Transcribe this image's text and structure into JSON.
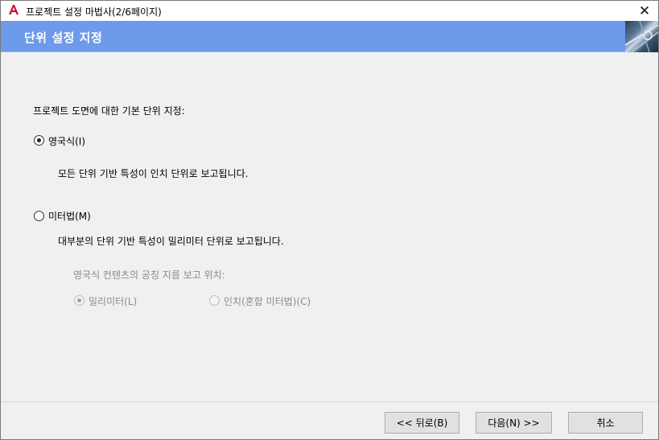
{
  "window": {
    "title": "프로젝트 설정 마법사(2/6페이지)",
    "close_glyph": "✕"
  },
  "header": {
    "title": "단위 설정 지정"
  },
  "main": {
    "prompt": "프로젝트 도면에 대한 기본 단위 지정:",
    "options": [
      {
        "label": "영국식(I)",
        "description": "모든 단위 기반 특성이 인치 단위로 보고됩니다.",
        "selected": true
      },
      {
        "label": "미터법(M)",
        "description": "대부분의 단위 기반 특성이 밀리미터 단위로 보고됩니다.",
        "selected": false
      }
    ],
    "sub_section": {
      "label": "영국식 컨텐츠의 공칭 지름 보고 위치:",
      "options": [
        {
          "label": "밀리미터(L)",
          "selected": true,
          "enabled": false
        },
        {
          "label": "인치(혼합 미터법)(C)",
          "selected": false,
          "enabled": false
        }
      ]
    }
  },
  "footer": {
    "back_label": "<< 뒤로(B)",
    "next_label": "다음(N) >>",
    "cancel_label": "취소"
  },
  "colors": {
    "header_band": "#6d9aea",
    "app_icon_red": "#c8102e"
  },
  "icons": {
    "app": "autocad-logo-icon",
    "close": "close-icon"
  }
}
